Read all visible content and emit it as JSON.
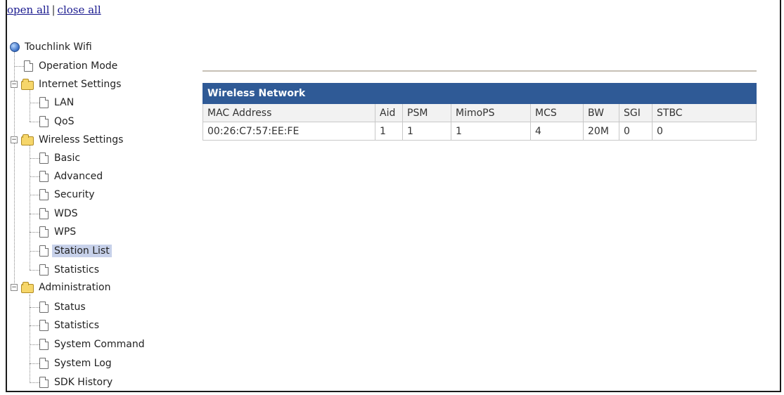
{
  "toplinks": {
    "open_all": "open all",
    "separator": "|",
    "close_all": "close all"
  },
  "tree": {
    "root": "Touchlink Wifi",
    "operation_mode": "Operation Mode",
    "internet_settings": {
      "label": "Internet Settings",
      "children": [
        "LAN",
        "QoS"
      ]
    },
    "wireless_settings": {
      "label": "Wireless Settings",
      "children": [
        "Basic",
        "Advanced",
        "Security",
        "WDS",
        "WPS",
        "Station List",
        "Statistics"
      ],
      "selected": "Station List"
    },
    "administration": {
      "label": "Administration",
      "children": [
        "Status",
        "Statistics",
        "System Command",
        "System Log",
        "SDK History"
      ]
    }
  },
  "station_table": {
    "title": "Wireless Network",
    "columns": [
      "MAC Address",
      "Aid",
      "PSM",
      "MimoPS",
      "MCS",
      "BW",
      "SGI",
      "STBC"
    ],
    "rows": [
      [
        "00:26:C7:57:EE:FE",
        "1",
        "1",
        "1",
        "4",
        "20M",
        "0",
        "0"
      ]
    ]
  },
  "colors": {
    "table_header": "#2f5a96",
    "selected_bg": "#c7d1ea",
    "link": "#1a1a8f"
  }
}
